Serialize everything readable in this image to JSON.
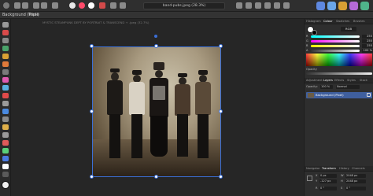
{
  "toolbar": {
    "doc_title": "band-pubs.jpeg (28.3%)"
  },
  "context": {
    "layer_label": "Background (Pixel)",
    "mode": "Triple"
  },
  "canvas": {
    "doc_path": "MYSTIC STEAMPUNK DEPT BY PORTRAIT & TRANSCEND + .jpeg (32.7%)"
  },
  "panel": {
    "top_tabs": [
      "Histogram",
      "Colour",
      "Swatches",
      "Brushes"
    ],
    "active_top_tab": "Colour",
    "color_mode": "RGB",
    "sliders": [
      {
        "label": "R",
        "value": "255"
      },
      {
        "label": "G",
        "value": "255"
      },
      {
        "label": "B",
        "value": "255"
      },
      {
        "label": "A",
        "value": "100 %"
      }
    ],
    "opacity_label": "Opacity",
    "layer_tabs": [
      "Adjustment",
      "Layers",
      "Effects",
      "Styles",
      "Stock"
    ],
    "active_layer_tab": "Layers",
    "layer_opacity_label": "Opacity:",
    "layer_opacity": "100 %",
    "blend_mode": "Normal",
    "layer_name": "Background (Pixel)",
    "transform_tabs": [
      "Navigator",
      "Transform",
      "History",
      "Channels"
    ],
    "active_transform_tab": "Transform",
    "transform": {
      "x": "0 px",
      "y": "-127 px",
      "w": "2048 px",
      "h": "2048 px",
      "r": "0 °",
      "s": "0 °"
    }
  },
  "colors": {
    "accent": "#3b6fd6",
    "layer_selected": "#3f5f9e"
  }
}
